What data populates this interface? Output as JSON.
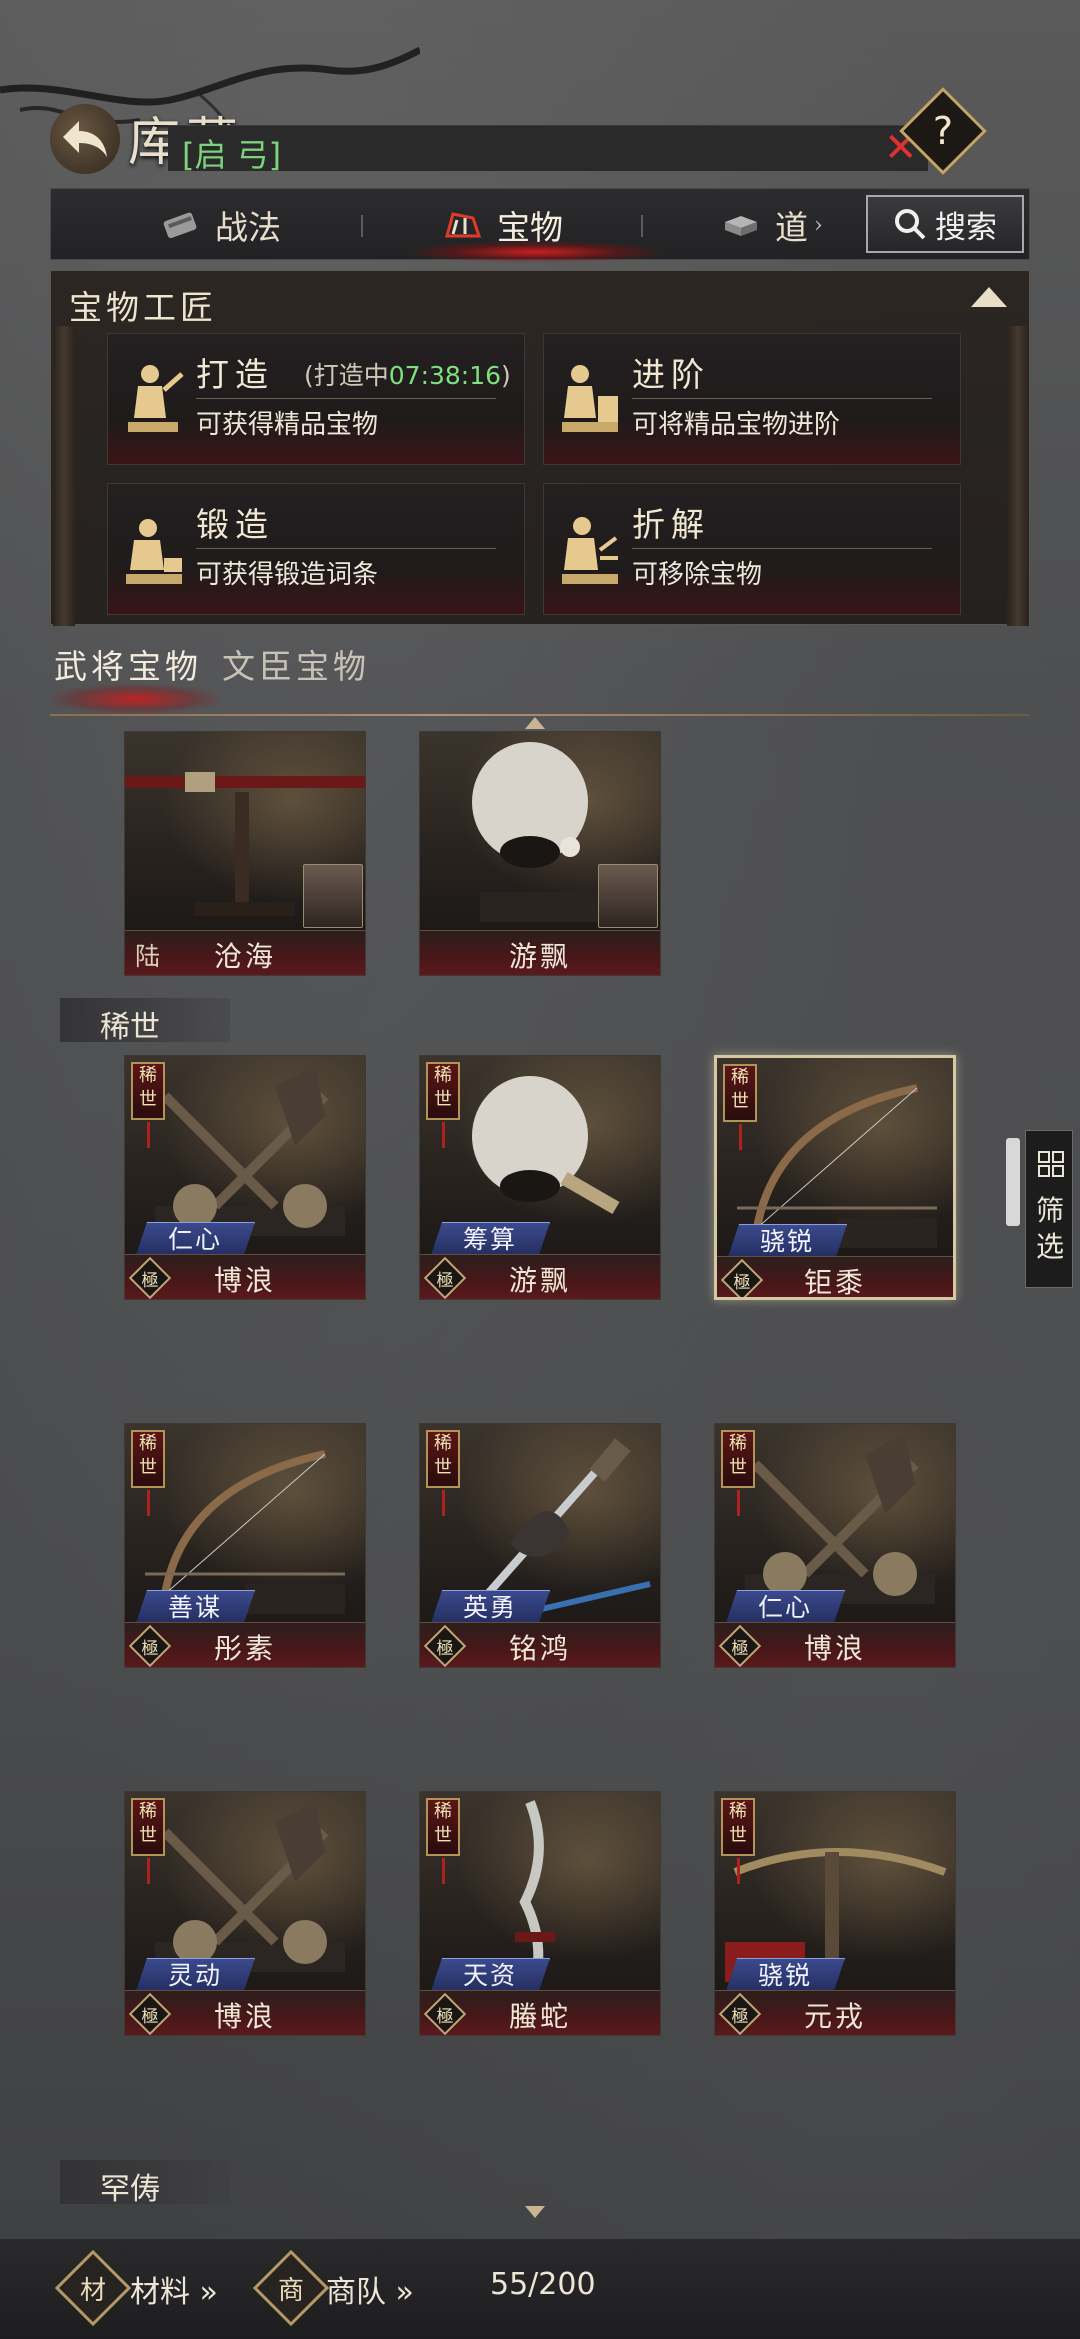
{
  "header": {
    "title": "库藏",
    "search_value": "[启 弓]",
    "clear_icon": "close-icon",
    "help_label": "?"
  },
  "tabs": [
    {
      "label": "战法",
      "icon": "scroll-icon",
      "active": false
    },
    {
      "label": "宝物",
      "icon": "treasure-icon",
      "active": true
    },
    {
      "label": "道具",
      "icon": "item-icon",
      "active": false
    }
  ],
  "tab_truncated_label": "道",
  "search_button": "搜索",
  "craftsman": {
    "title": "宝物工匠",
    "actions": [
      {
        "name": "打造",
        "timer_prefix": "(打造中",
        "timer": "07:38:16",
        "timer_suffix": ")",
        "desc": "可获得精品宝物"
      },
      {
        "name": "进阶",
        "desc": "可将精品宝物进阶"
      },
      {
        "name": "锻造",
        "desc": "可获得锻造词条"
      },
      {
        "name": "折解",
        "desc": "可移除宝物"
      }
    ]
  },
  "categories": [
    {
      "label": "武将宝物",
      "active": true
    },
    {
      "label": "文臣宝物",
      "active": false
    }
  ],
  "top_row": [
    {
      "name": "沧海",
      "prefix": "陆",
      "has_hero": true
    },
    {
      "name": "游飘",
      "prefix": "",
      "has_hero": true
    }
  ],
  "sections": [
    {
      "label": "稀世"
    },
    {
      "label": "罕俦"
    }
  ],
  "rare_badge": "稀世",
  "grade_badge": "極",
  "cards": [
    {
      "name": "博浪",
      "trait": "仁心",
      "art": "mace",
      "selected": false
    },
    {
      "name": "游飘",
      "trait": "筹算",
      "art": "fan",
      "selected": false
    },
    {
      "name": "钜黍",
      "trait": "骁锐",
      "art": "bow",
      "selected": true
    },
    {
      "name": "彤素",
      "trait": "善谋",
      "art": "bow",
      "selected": false
    },
    {
      "name": "铭鸿",
      "trait": "英勇",
      "art": "sword",
      "selected": false
    },
    {
      "name": "博浪",
      "trait": "仁心",
      "art": "mace",
      "selected": false
    },
    {
      "name": "博浪",
      "trait": "灵动",
      "art": "mace",
      "selected": false
    },
    {
      "name": "螣蛇",
      "trait": "天资",
      "art": "blade",
      "selected": false
    },
    {
      "name": "元戎",
      "trait": "骁锐",
      "art": "crossbow",
      "selected": false
    }
  ],
  "filter": {
    "label": "筛选",
    "icon": "grid-icon"
  },
  "bottom_bar": {
    "materials_label": "材料 »",
    "materials_icon": "材",
    "caravan_label": "商队 »",
    "caravan_icon": "商",
    "count": "55/200"
  },
  "colors": {
    "accent_red": "#b02020",
    "timer_green": "#7fe07f",
    "trait_blue": "#3b4a8c",
    "gold_border": "#c1a576"
  }
}
